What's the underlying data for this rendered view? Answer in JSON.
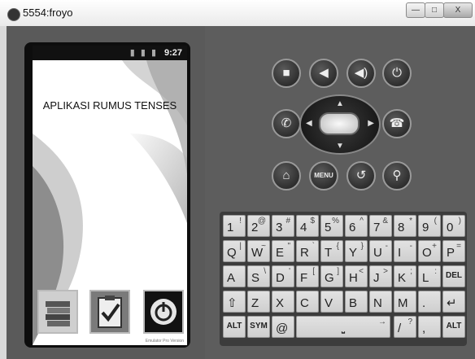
{
  "window": {
    "title": "5554:froyo",
    "minimize": "—",
    "maximize": "□",
    "close": "X"
  },
  "statusbar": {
    "icons": "▮ ▮ ▮",
    "time": "9:27"
  },
  "app": {
    "title": "APLIKASI RUMUS TENSES",
    "footer": "Emulator Pro Version"
  },
  "keyboard": {
    "rows": [
      [
        [
          "1",
          "!"
        ],
        [
          "2",
          "@"
        ],
        [
          "3",
          "#"
        ],
        [
          "4",
          "$"
        ],
        [
          "5",
          "%"
        ],
        [
          "6",
          "^"
        ],
        [
          "7",
          "&"
        ],
        [
          "8",
          "*"
        ],
        [
          "9",
          "("
        ],
        [
          "0",
          ")"
        ]
      ],
      [
        [
          "Q",
          "|"
        ],
        [
          "W",
          "~"
        ],
        [
          "E",
          "\""
        ],
        [
          "R",
          "`"
        ],
        [
          "T",
          "{"
        ],
        [
          "Y",
          "}"
        ],
        [
          "U",
          "-"
        ],
        [
          "I",
          "-"
        ],
        [
          "O",
          "+"
        ],
        [
          "P",
          "="
        ]
      ],
      [
        [
          "A",
          ""
        ],
        [
          "S",
          "\\"
        ],
        [
          "D",
          "'"
        ],
        [
          "F",
          "["
        ],
        [
          "G",
          "]"
        ],
        [
          "H",
          "<"
        ],
        [
          "J",
          ">"
        ],
        [
          "K",
          ";"
        ],
        [
          "L",
          ":"
        ],
        [
          "DEL",
          ""
        ]
      ],
      [
        [
          "⇧",
          ""
        ],
        [
          "Z",
          ""
        ],
        [
          "X",
          ""
        ],
        [
          "C",
          ""
        ],
        [
          "V",
          ""
        ],
        [
          "B",
          ""
        ],
        [
          "N",
          ""
        ],
        [
          "M",
          ""
        ],
        [
          ".",
          ""
        ],
        [
          "↵",
          ""
        ]
      ]
    ],
    "bottom": {
      "alt_left": "ALT",
      "sym": "SYM",
      "at": "@",
      "space": "⎵",
      "slash": "/",
      "slash_alt": "?",
      "comma": ",",
      "alt_right": "ALT",
      "space_alt": "→"
    }
  },
  "controls": {
    "menu": "MENU"
  }
}
